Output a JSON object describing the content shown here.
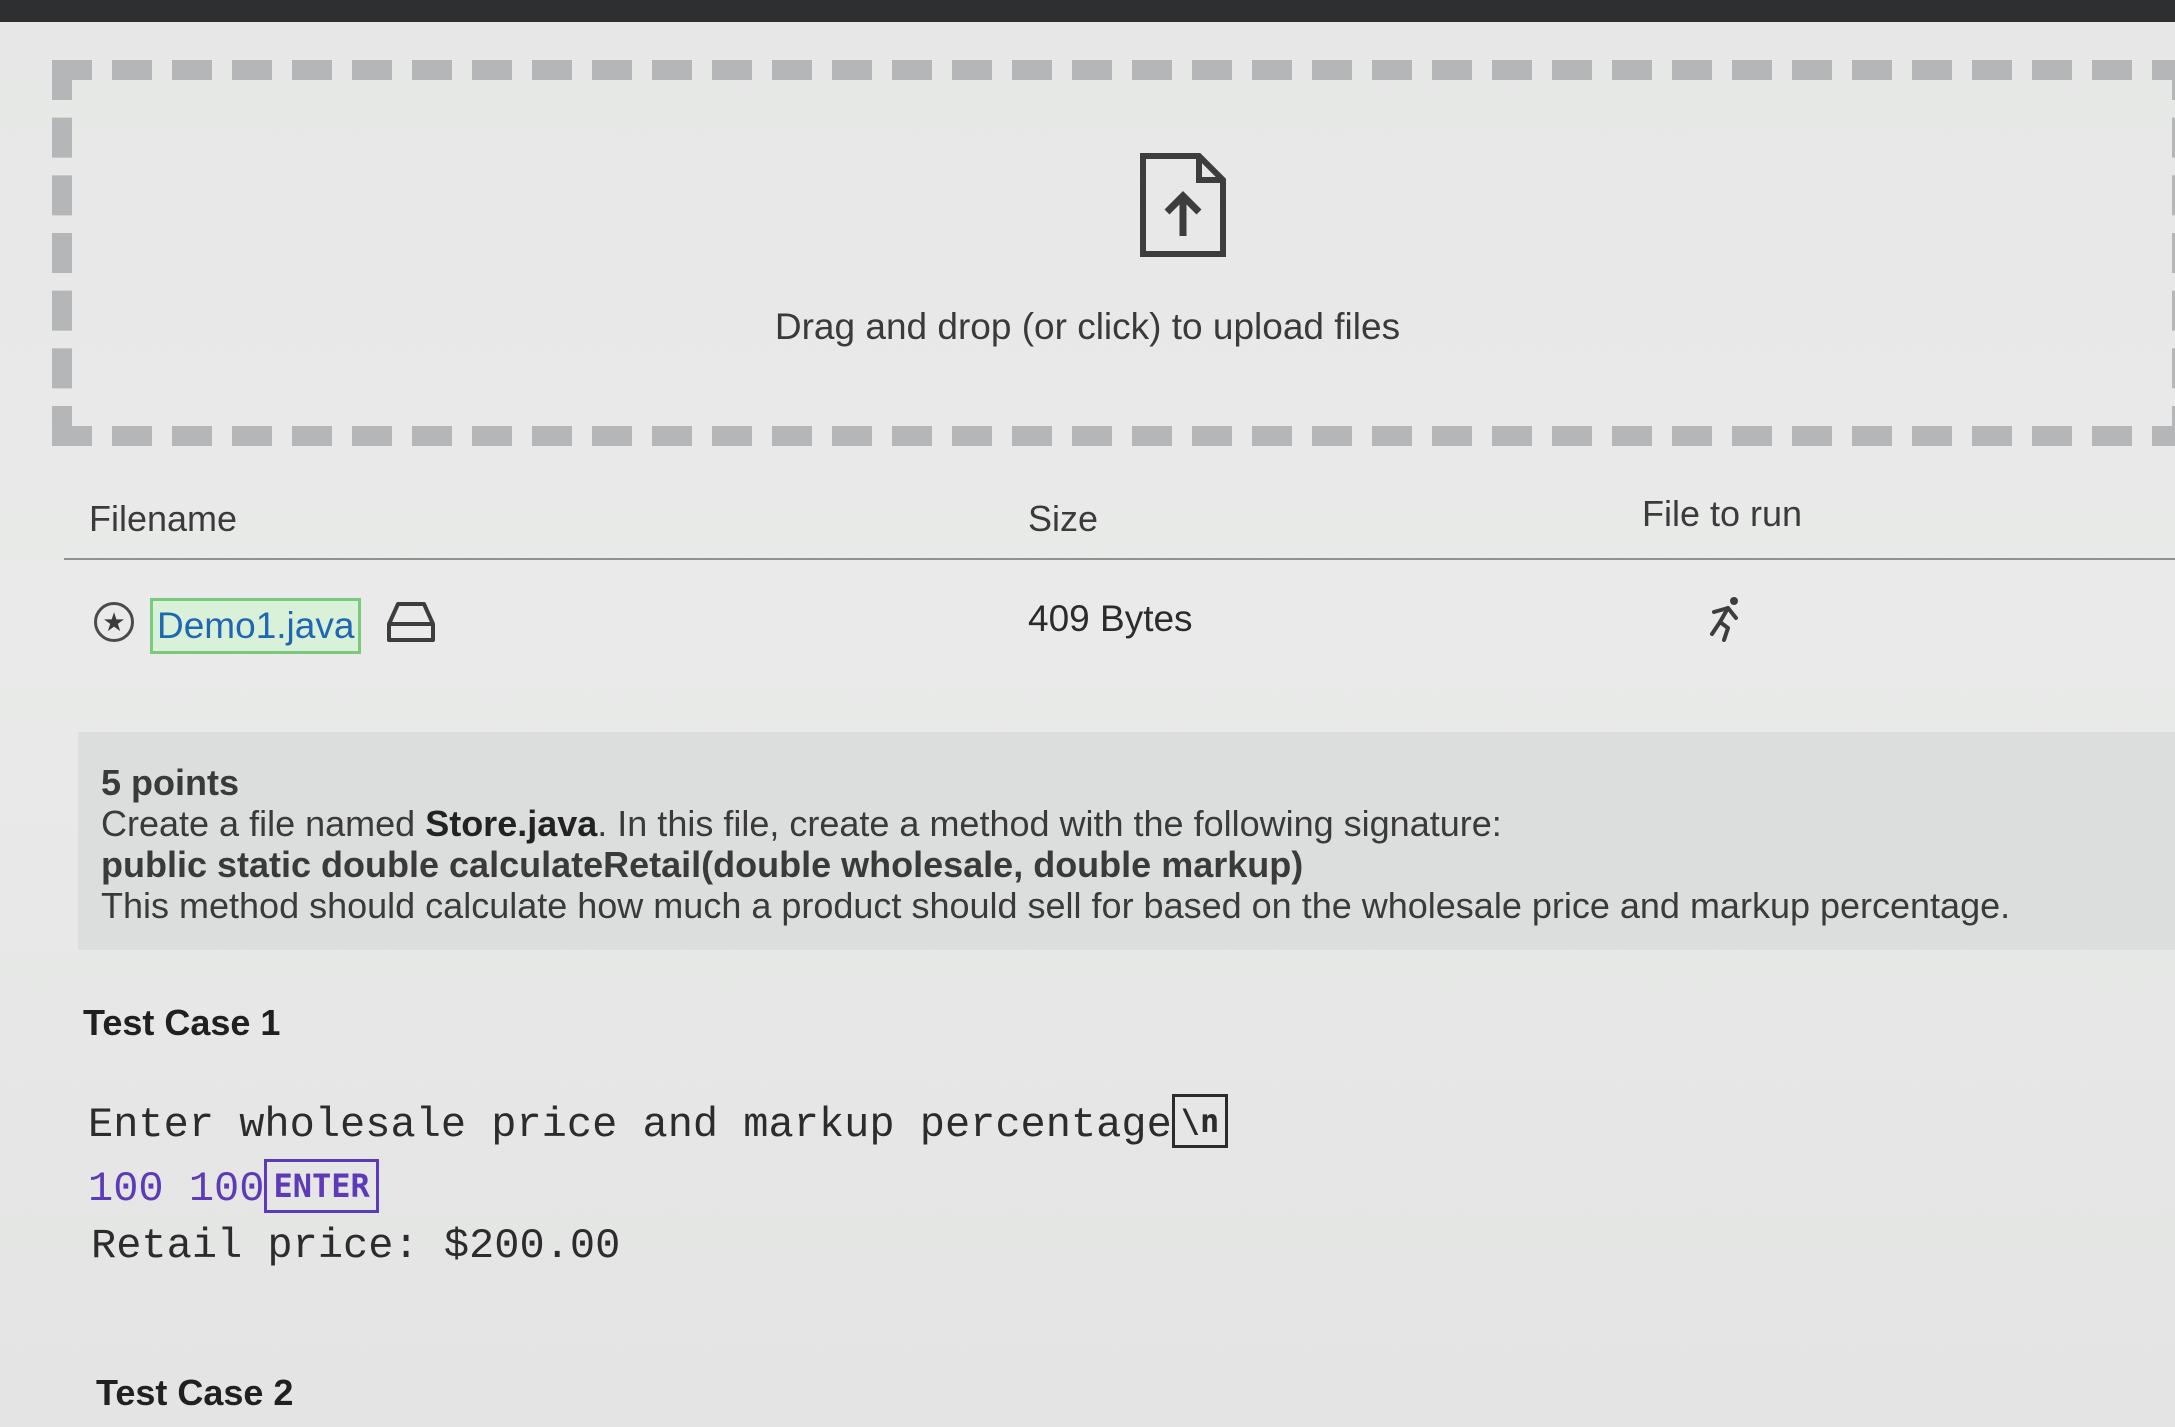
{
  "upload": {
    "icon": "file-upload-icon",
    "text": "Drag and drop (or click) to upload files"
  },
  "table": {
    "headers": {
      "filename": "Filename",
      "size": "Size",
      "file_to_run": "File to run"
    },
    "rows": [
      {
        "filename": "Demo1.java",
        "size": "409 Bytes",
        "icons": [
          "star-icon",
          "drive-icon",
          "run-icon"
        ]
      }
    ]
  },
  "description": {
    "points": "5 points",
    "line1_prefix": "Create a file named ",
    "line1_filename": "Store.java",
    "line1_suffix": ". In this file, create a method with the following signature:",
    "signature": "public static double calculateRetail(double wholesale, double markup)",
    "line3": "This method should calculate how much a product should sell for based on the wholesale price and markup percentage."
  },
  "test_cases": [
    {
      "title": "Test Case 1",
      "prompt": "Enter wholesale price and markup percentage",
      "prompt_key": "\\n",
      "input": "100 100",
      "input_key": "ENTER",
      "output": "Retail price: $200.00"
    },
    {
      "title": "Test Case 2"
    }
  ],
  "colors": {
    "link": "#1f67b3",
    "link_highlight_border": "#7bc97b",
    "input_text": "#5d3bb8",
    "dash_border": "#b4b6b7"
  }
}
